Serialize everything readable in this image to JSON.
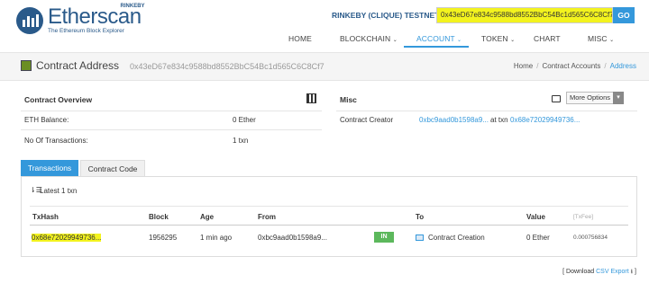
{
  "brand": {
    "name": "Etherscan",
    "subtitle": "The Ethereum Block Explorer",
    "network_tag": "RINKEBY"
  },
  "header": {
    "network_label": "RINKEBY (CLIQUE) TESTNET",
    "search_value": "0x43eD67e834c9588bd8552BbC54Bc1d565C6C8Cf7",
    "go_label": "GO",
    "search_highlight_color": "#f3f31e"
  },
  "nav": {
    "items": [
      "HOME",
      "BLOCKCHAIN",
      "ACCOUNT",
      "TOKEN",
      "CHART",
      "MISC"
    ],
    "active": "ACCOUNT"
  },
  "page": {
    "title": "Contract Address",
    "address": "0x43eD67e834c9588bd8552BbC54Bc1d565C6C8Cf7",
    "breadcrumb": [
      "Home",
      "Contract Accounts",
      "Address"
    ]
  },
  "overview": {
    "title": "Contract Overview",
    "balance_label": "ETH Balance:",
    "balance_value": "0 Ether",
    "tx_label": "No Of Transactions:",
    "tx_value": "1 txn"
  },
  "misc": {
    "title": "Misc",
    "more_options": "More Options",
    "creator_label": "Contract Creator",
    "creator_address": "0xbc9aad0b1598a9...",
    "at_txn": "at txn",
    "creator_txn": "0x68e72029949736..."
  },
  "tabs": [
    "Transactions",
    "Contract Code"
  ],
  "transactions": {
    "summary": "Latest 1 txn",
    "columns": [
      "TxHash",
      "Block",
      "Age",
      "From",
      "To",
      "Value",
      "[TxFee]"
    ],
    "rows": [
      {
        "txhash": "0x68e72029949736...",
        "block": "1956295",
        "age": "1 min ago",
        "from": "0xbc9aad0b1598a9...",
        "direction": "IN",
        "to": "Contract Creation",
        "value": "0 Ether",
        "fee": "0.000756834"
      }
    ]
  },
  "footer": {
    "prefix": "[ Download",
    "link": "CSV Export",
    "suffix": "]"
  }
}
